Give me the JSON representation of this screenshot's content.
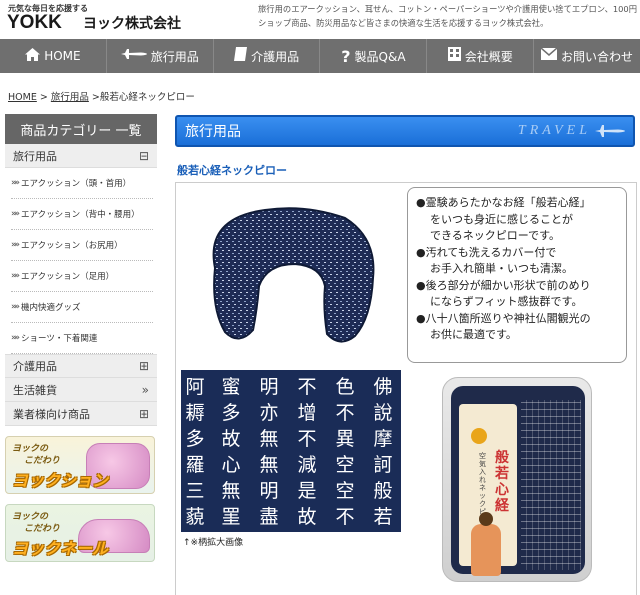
{
  "header": {
    "tagline": "元気な毎日を応援する",
    "logo_latin": "YOKK",
    "logo_jp": "ヨック株式会社",
    "description": "旅行用のエアークッション、耳せん、コットン・ペーパーショーツや介護用使い捨てエプロン、100円ショップ商品、防災用品など皆さまの快適な生活を応援するヨック株式会社。"
  },
  "nav": [
    {
      "label": "HOME",
      "icon": "home-icon"
    },
    {
      "label": "旅行用品",
      "icon": "airplane-icon"
    },
    {
      "label": "介護用品",
      "icon": "book-icon"
    },
    {
      "label": "製品Q&A",
      "icon": "question-icon"
    },
    {
      "label": "会社概要",
      "icon": "building-icon"
    },
    {
      "label": "お問い合わせ",
      "icon": "mail-icon"
    }
  ],
  "breadcrumb": {
    "home": "HOME",
    "sep1": ">",
    "category": "旅行用品",
    "sep2": ">",
    "current": "般若心経ネックピロー"
  },
  "sidebar": {
    "heading": "商品カテゴリー 一覧",
    "travel": {
      "label": "旅行用品",
      "mark": "⊟"
    },
    "sub_items": [
      "エアクッション（頭・首用）",
      "エアクッション（背中・腰用）",
      "エアクッション（お尻用）",
      "エアクッション（足用）",
      "機内快適グッズ",
      "ショーツ・下着関連"
    ],
    "categories": [
      {
        "label": "介護用品",
        "mark": "⊞"
      },
      {
        "label": "生活雑貨",
        "mark": "»"
      },
      {
        "label": "業者様向け商品",
        "mark": "⊞"
      }
    ],
    "banners": [
      {
        "line1": "ヨックの",
        "line2": "こだわり",
        "title": "ヨックション"
      },
      {
        "line1": "ヨックの",
        "line2": "こだわり",
        "title": "ヨックネール"
      }
    ]
  },
  "main": {
    "section_title": "旅行用品",
    "section_tag": "TRAVEL",
    "product_title": "般若心経ネックピロー",
    "description_lines": [
      {
        "text": "●霊験あらたかなお経「般若心経」",
        "indent": false
      },
      {
        "text": "をいつも身近に感じることが",
        "indent": true
      },
      {
        "text": "できるネックピローです。",
        "indent": true
      },
      {
        "text": "●汚れても洗えるカバー付で",
        "indent": false
      },
      {
        "text": "お手入れ簡単・いつも清潔。",
        "indent": true
      },
      {
        "text": "●後ろ部分が細かい形状で前のめり",
        "indent": false
      },
      {
        "text": "にならずフィット感抜群です。",
        "indent": false
      },
      {
        "text": "●八十八箇所巡りや神社仏閣観光の",
        "indent": false
      },
      {
        "text": "お供に最適です。",
        "indent": true
      }
    ],
    "kanji_columns": [
      "佛說摩訶般若波",
      "色不異空空不異",
      "不增不減是故空",
      "明亦無無明盡乃",
      "蜜多故心無罣礙",
      "阿耨多羅三藐三"
    ],
    "caption": "↑※柄拡大画像",
    "package_title": "般若心経",
    "package_sub": "空気入れネックピロー"
  }
}
